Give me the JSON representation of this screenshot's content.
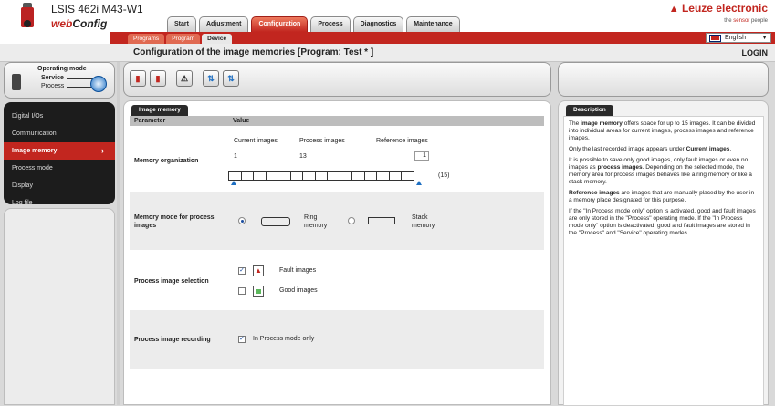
{
  "header": {
    "device_name": "LSIS 462i M43-W1",
    "app_name_a": "web",
    "app_name_b": "Config",
    "brand": "Leuze electronic",
    "brand_sub_a": "the ",
    "brand_sub_b": "sensor",
    "brand_sub_c": " people",
    "language": "English"
  },
  "main_tabs": [
    {
      "label": "Start"
    },
    {
      "label": "Adjustment"
    },
    {
      "label": "Configuration"
    },
    {
      "label": "Process"
    },
    {
      "label": "Diagnostics"
    },
    {
      "label": "Maintenance"
    }
  ],
  "sub_tabs": [
    {
      "label": "Programs"
    },
    {
      "label": "Program"
    },
    {
      "label": "Device"
    }
  ],
  "title": "Configuration of the image memories   [Program: Test * ]",
  "login": "LOGIN",
  "operating_mode": {
    "label": "Operating mode",
    "service": "Service",
    "process": "Process"
  },
  "toolbar": {
    "icons": [
      "save-to-device-icon",
      "load-from-device-icon",
      "warning-icon",
      "transfer-up-icon",
      "transfer-down-icon"
    ],
    "glyphs": [
      "▮",
      "▮",
      "⚠",
      "⇅",
      "⇅"
    ]
  },
  "nav": [
    {
      "label": "Digital I/Os"
    },
    {
      "label": "Communication"
    },
    {
      "label": "Image memory"
    },
    {
      "label": "Process mode"
    },
    {
      "label": "Display"
    },
    {
      "label": "Log file"
    }
  ],
  "content": {
    "section_tab": "Image memory",
    "col_parameter": "Parameter",
    "col_value": "Value",
    "memory_org": {
      "label": "Memory organization",
      "current_label": "Current images",
      "process_label": "Process images",
      "reference_label": "Reference images",
      "current_value": "1",
      "process_value": "13",
      "reference_value": "1",
      "total": "(15)"
    },
    "memory_mode": {
      "label": "Memory mode for process images",
      "ring": "Ring memory",
      "stack": "Stack memory"
    },
    "selection": {
      "label": "Process image selection",
      "fault": "Fault images",
      "good": "Good images"
    },
    "recording": {
      "label": "Process image recording",
      "option": "In Process mode only"
    }
  },
  "description": {
    "tab": "Description",
    "p1_pre": "The ",
    "p1_bold": "image memory",
    "p1_post": " offers space for up to 15 images. It can be divided into individual areas for current images, process images and reference images.",
    "p2_pre": "Only the last recorded image appears under ",
    "p2_bold": "Current images",
    "p2_post": ".",
    "p3_pre": "It is possible to save only good images, only fault images or even no images as ",
    "p3_bold": "process images",
    "p3_post": ". Depending on the selected mode, the memory area for process images behaves like a ring memory or like a stack memory.",
    "p4_bold": "Reference images",
    "p4_post": " are images that are manually placed by the user in a memory place designated for this purpose.",
    "p5": "If the \"In Process mode only\" option is activated, good and fault images are only stored in the \"Process\" operating mode. If the \"In Process mode only\" option is deactivated, good and fault images are stored in the \"Process\" and \"Service\" operating modes."
  }
}
